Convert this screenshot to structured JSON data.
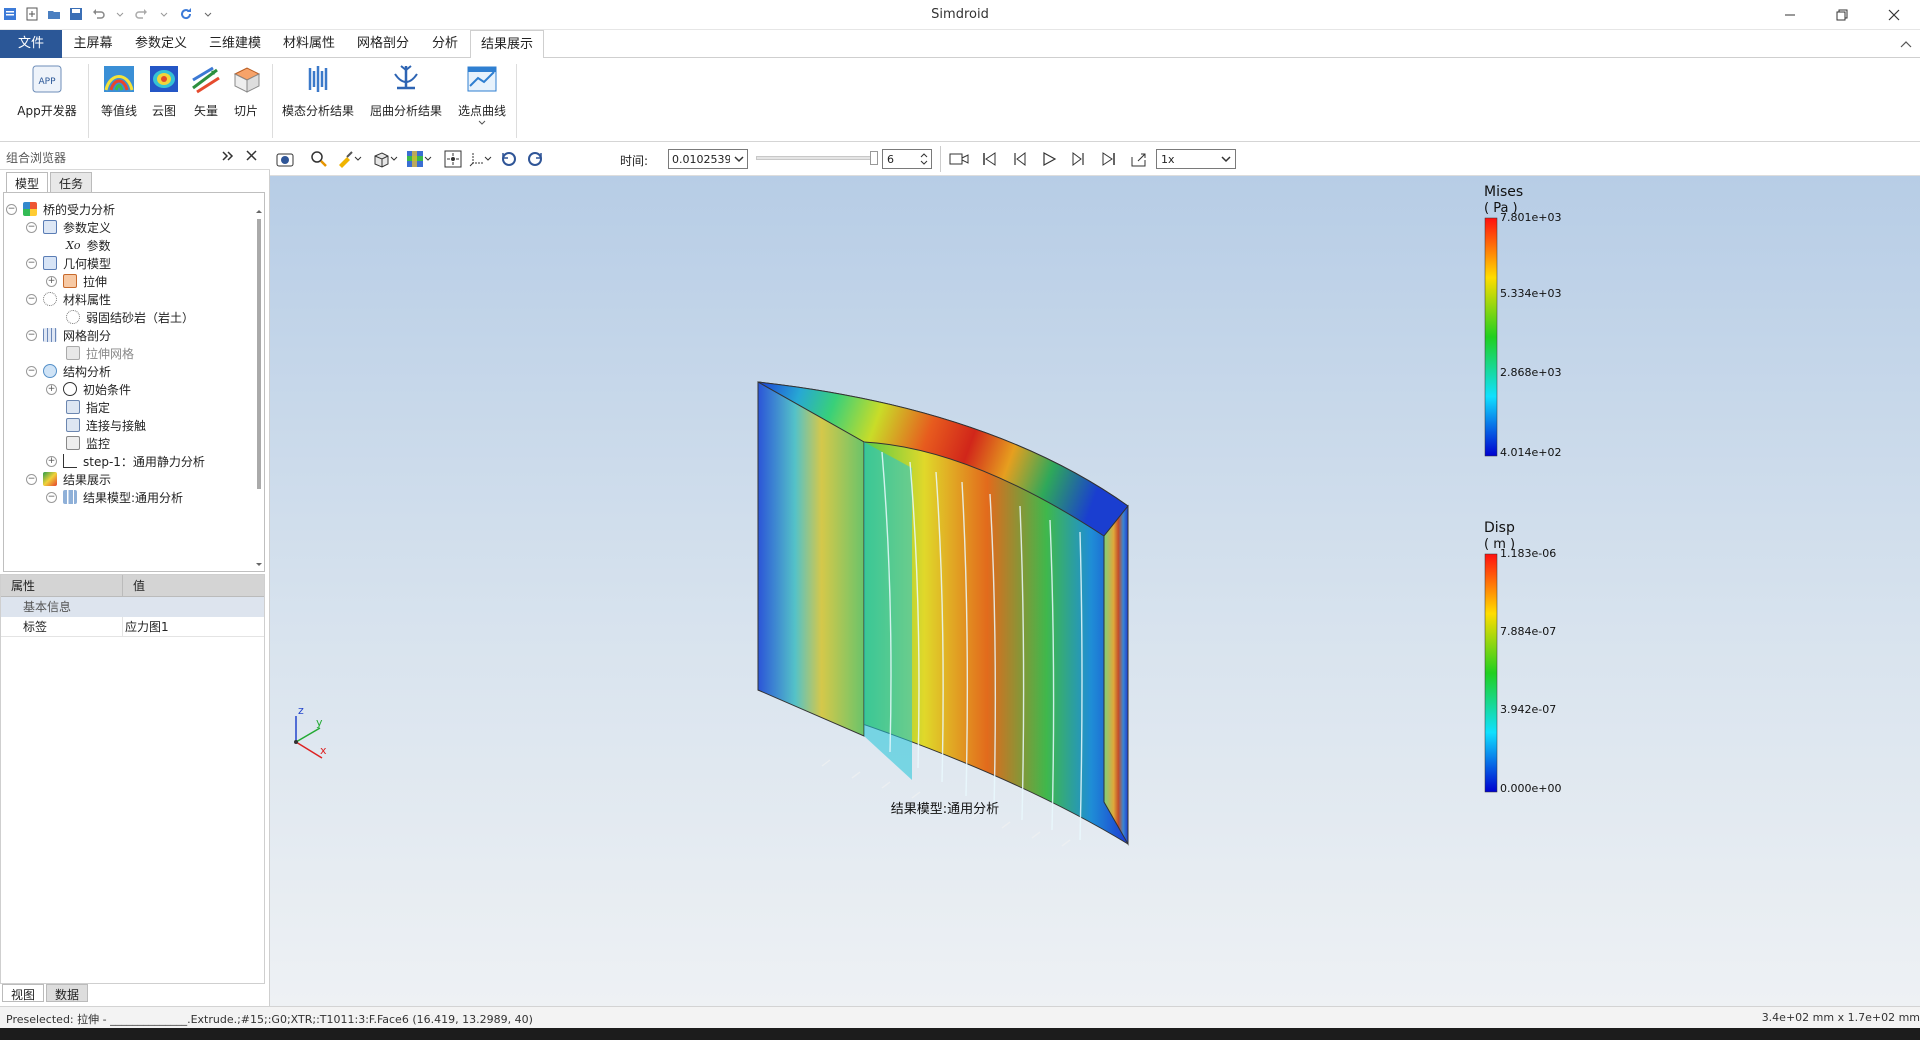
{
  "app": {
    "title": "Simdroid"
  },
  "ribbon_tabs": [
    "文件",
    "主屏幕",
    "参数定义",
    "三维建模",
    "材料属性",
    "网格剖分",
    "分析",
    "结果展示"
  ],
  "ribbon_buttons": [
    "App开发器",
    "等值线",
    "云图",
    "矢量",
    "切片",
    "模态分析结果",
    "屈曲分析结果",
    "选点曲线"
  ],
  "browser": {
    "title": "组合浏览器",
    "tabs": [
      "模型",
      "任务"
    ],
    "tree": [
      {
        "label": "桥的受力分析"
      },
      {
        "label": "参数定义"
      },
      {
        "label": "参数",
        "prefix": "Xo"
      },
      {
        "label": "几何模型"
      },
      {
        "label": "拉伸"
      },
      {
        "label": "材料属性"
      },
      {
        "label": "弱固结砂岩（岩土）"
      },
      {
        "label": "网格剖分"
      },
      {
        "label": "拉伸网格"
      },
      {
        "label": "结构分析"
      },
      {
        "label": "初始条件"
      },
      {
        "label": "指定"
      },
      {
        "label": "连接与接触"
      },
      {
        "label": "监控"
      },
      {
        "label": "step-1：通用静力分析"
      },
      {
        "label": "结果展示"
      },
      {
        "label": "结果模型:通用分析"
      }
    ]
  },
  "properties": {
    "col_property": "属性",
    "col_value": "值",
    "group": "基本信息",
    "row_label": "标签",
    "row_value": "应力图1"
  },
  "bottom_tabs": [
    "视图",
    "数据"
  ],
  "viewtoolbar": {
    "time_label": "时间:",
    "time_value": "0.0102539",
    "frame_value": "6",
    "speed_value": "1x"
  },
  "viewport": {
    "model_caption": "结果模型:通用分析",
    "legend_mises": {
      "title": "Mises",
      "unit": "( Pa )",
      "ticks": [
        "7.801e+03",
        "5.334e+03",
        "2.868e+03",
        "4.014e+02"
      ]
    },
    "legend_disp": {
      "title": "Disp",
      "unit": "( m )",
      "ticks": [
        "1.183e-06",
        "7.884e-07",
        "3.942e-07",
        "0.000e+00"
      ]
    },
    "axes": {
      "x": "x",
      "y": "y",
      "z": "z"
    }
  },
  "status": {
    "left": "Preselected: 拉伸 - ______________.Extrude.;#15;:G0;XTR;:T1011:3:F.Face6 (16.419, 13.2989, 40)",
    "right": "3.4e+02 mm x 1.7e+02 mm"
  },
  "colors": {
    "file_tab": "#2b5797",
    "accent": "#2b5797"
  }
}
